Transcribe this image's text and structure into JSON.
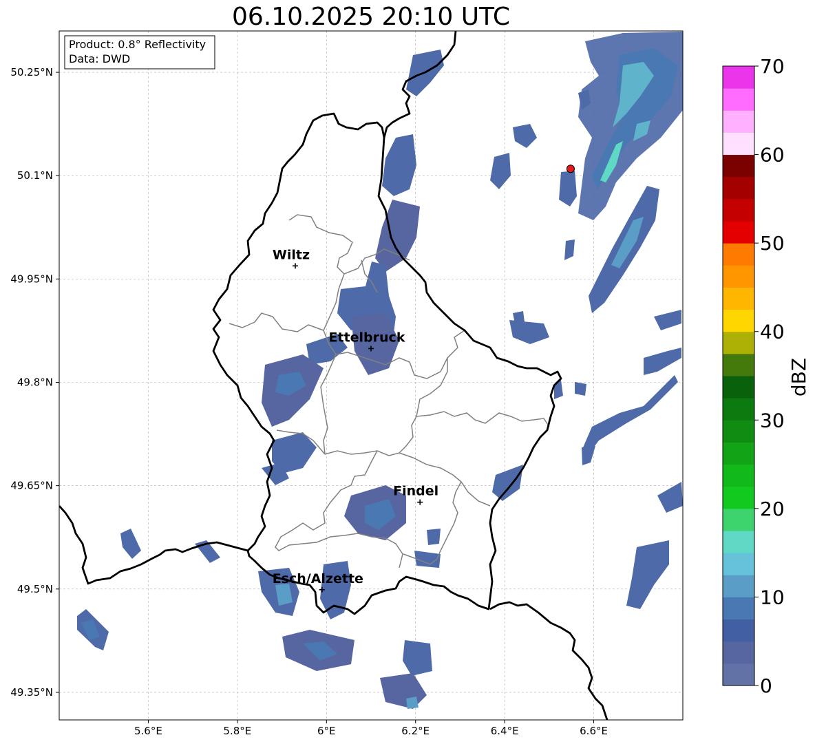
{
  "title": "06.10.2025 20:10 UTC",
  "infobox": {
    "product": "Product: 0.8° Reflectivity",
    "source": "Data: DWD"
  },
  "map": {
    "lon_range": [
      5.4,
      6.8
    ],
    "lat_range": [
      49.31,
      50.31
    ],
    "lon_ticks": [
      {
        "value": 5.6,
        "label": "5.6°E"
      },
      {
        "value": 5.8,
        "label": "5.8°E"
      },
      {
        "value": 6.0,
        "label": "6°E"
      },
      {
        "value": 6.2,
        "label": "6.2°E"
      },
      {
        "value": 6.4,
        "label": "6.4°E"
      },
      {
        "value": 6.6,
        "label": "6.6°E"
      }
    ],
    "lat_ticks": [
      {
        "value": 50.25,
        "label": "50.25°N"
      },
      {
        "value": 50.1,
        "label": "50.1°N"
      },
      {
        "value": 49.95,
        "label": "49.95°N"
      },
      {
        "value": 49.8,
        "label": "49.8°N"
      },
      {
        "value": 49.65,
        "label": "49.65°N"
      },
      {
        "value": 49.5,
        "label": "49.5°N"
      },
      {
        "value": 49.35,
        "label": "49.35°N"
      }
    ],
    "gridlines": true,
    "cities": [
      {
        "name": "Wiltz",
        "lon": 5.93,
        "lat": 49.969
      },
      {
        "name": "Ettelbruck",
        "lon": 6.1,
        "lat": 49.849
      },
      {
        "name": "Findel",
        "lon": 6.21,
        "lat": 49.626
      },
      {
        "name": "Esch/Alzette",
        "lon": 5.99,
        "lat": 49.499
      }
    ],
    "marker": {
      "lon": 6.548,
      "lat": 50.11,
      "color": "#e31a1c"
    },
    "colors": {
      "border": "#000000",
      "cantons": "#808080",
      "grid": "#b0b0b0"
    }
  },
  "colorbar": {
    "label": "dBZ",
    "ticks": [
      0,
      10,
      20,
      30,
      40,
      50,
      60,
      70
    ],
    "min": 0,
    "max": 70,
    "bins": [
      {
        "from": 0,
        "to": 2.5,
        "color": "#6271a6"
      },
      {
        "from": 2.5,
        "to": 5,
        "color": "#5766a0"
      },
      {
        "from": 5,
        "to": 7.5,
        "color": "#435fa3"
      },
      {
        "from": 7.5,
        "to": 10,
        "color": "#4a78b2"
      },
      {
        "from": 10,
        "to": 12.5,
        "color": "#5a9dc7"
      },
      {
        "from": 12.5,
        "to": 15,
        "color": "#66c2db"
      },
      {
        "from": 15,
        "to": 17.5,
        "color": "#5fd8c5"
      },
      {
        "from": 17.5,
        "to": 20,
        "color": "#3dd46e"
      },
      {
        "from": 20,
        "to": 22.5,
        "color": "#12c91f"
      },
      {
        "from": 22.5,
        "to": 25,
        "color": "#12b91b"
      },
      {
        "from": 25,
        "to": 27.5,
        "color": "#12a316"
      },
      {
        "from": 27.5,
        "to": 30,
        "color": "#108c13"
      },
      {
        "from": 30,
        "to": 32.5,
        "color": "#0d7a10"
      },
      {
        "from": 32.5,
        "to": 35,
        "color": "#09610c"
      },
      {
        "from": 35,
        "to": 37.5,
        "color": "#44790c"
      },
      {
        "from": 37.5,
        "to": 40,
        "color": "#adb005"
      },
      {
        "from": 40,
        "to": 42.5,
        "color": "#ffd600"
      },
      {
        "from": 42.5,
        "to": 45,
        "color": "#ffb600"
      },
      {
        "from": 45,
        "to": 47.5,
        "color": "#ff9600"
      },
      {
        "from": 47.5,
        "to": 50,
        "color": "#ff7a00"
      },
      {
        "from": 50,
        "to": 52.5,
        "color": "#e40000"
      },
      {
        "from": 52.5,
        "to": 55,
        "color": "#c40000"
      },
      {
        "from": 55,
        "to": 57.5,
        "color": "#a40000"
      },
      {
        "from": 57.5,
        "to": 60,
        "color": "#7b0000"
      },
      {
        "from": 60,
        "to": 62.5,
        "color": "#ffe0ff"
      },
      {
        "from": 62.5,
        "to": 65,
        "color": "#ffb0ff"
      },
      {
        "from": 65,
        "to": 67.5,
        "color": "#ff6cff"
      },
      {
        "from": 67.5,
        "to": 70,
        "color": "#ea35ea"
      }
    ]
  }
}
